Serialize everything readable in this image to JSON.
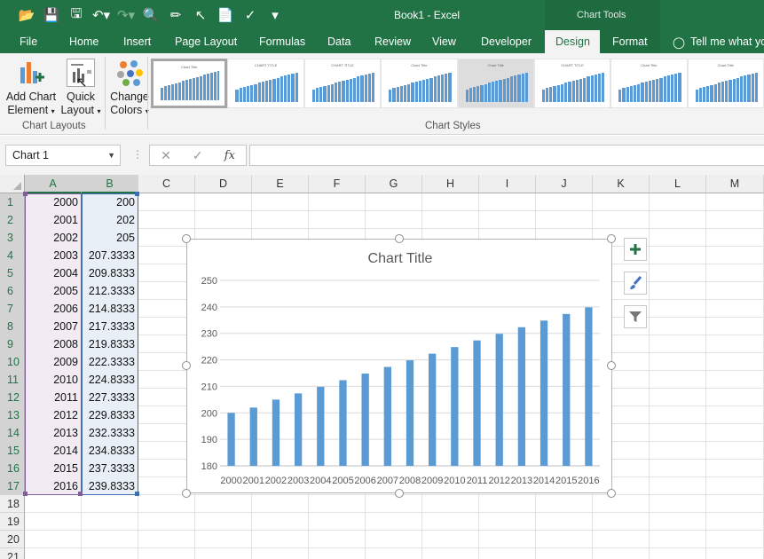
{
  "window": {
    "title": "Book1 - Excel",
    "context_group": "Chart Tools"
  },
  "ribbon_tabs": [
    {
      "label": "File"
    },
    {
      "label": "Home"
    },
    {
      "label": "Insert"
    },
    {
      "label": "Page Layout"
    },
    {
      "label": "Formulas"
    },
    {
      "label": "Data"
    },
    {
      "label": "Review"
    },
    {
      "label": "View"
    },
    {
      "label": "Developer"
    },
    {
      "label": "Design",
      "active": true
    },
    {
      "label": "Format"
    }
  ],
  "tell_me": "Tell me what yo",
  "ribbon": {
    "add_chart_element": [
      "Add Chart",
      "Element"
    ],
    "quick_layout": [
      "Quick",
      "Layout"
    ],
    "change_colors": [
      "Change",
      "Colors"
    ],
    "group_chart_layouts": "Chart Layouts",
    "group_chart_styles": "Chart Styles",
    "style_thumb_titles": [
      "Chart Title",
      "CHART TITLE",
      "CHART TITLE",
      "Chart Title",
      "Chart Title",
      "CHART TITLE",
      "Chart Title",
      "Chart Title"
    ]
  },
  "formula_bar": {
    "name_box": "Chart 1",
    "fx": "fx",
    "content": ""
  },
  "columns": [
    "A",
    "B",
    "C",
    "D",
    "E",
    "F",
    "G",
    "H",
    "I",
    "J",
    "K",
    "L",
    "M"
  ],
  "rows": [
    "1",
    "2",
    "3",
    "4",
    "5",
    "6",
    "7",
    "8",
    "9",
    "10",
    "11",
    "12",
    "13",
    "14",
    "15",
    "16",
    "17",
    "18",
    "19",
    "20",
    "21"
  ],
  "cells": {
    "A": [
      "2000",
      "2001",
      "2002",
      "2003",
      "2004",
      "2005",
      "2006",
      "2007",
      "2008",
      "2009",
      "2010",
      "2011",
      "2012",
      "2013",
      "2014",
      "2015",
      "2016"
    ],
    "B": [
      "200",
      "202",
      "205",
      "207.3333",
      "209.8333",
      "212.3333",
      "214.8333",
      "217.3333",
      "219.8333",
      "222.3333",
      "224.8333",
      "227.3333",
      "229.8333",
      "232.3333",
      "234.8333",
      "237.3333",
      "239.8333"
    ]
  },
  "chart_data": {
    "type": "bar",
    "title": "Chart Title",
    "categories": [
      "2000",
      "2001",
      "2002",
      "2003",
      "2004",
      "2005",
      "2006",
      "2007",
      "2008",
      "2009",
      "2010",
      "2011",
      "2012",
      "2013",
      "2014",
      "2015",
      "2016"
    ],
    "values": [
      200,
      202,
      205,
      207.3333,
      209.8333,
      212.3333,
      214.8333,
      217.3333,
      219.8333,
      222.3333,
      224.8333,
      227.3333,
      229.8333,
      232.3333,
      234.8333,
      237.3333,
      239.8333
    ],
    "ylim": [
      180,
      250
    ],
    "yticks": [
      "180",
      "190",
      "200",
      "210",
      "220",
      "230",
      "240",
      "250"
    ],
    "grid": true,
    "bar_color": "#5b9bd5"
  },
  "colors": {
    "brand": "#217346",
    "bar": "#5b9bd5"
  }
}
